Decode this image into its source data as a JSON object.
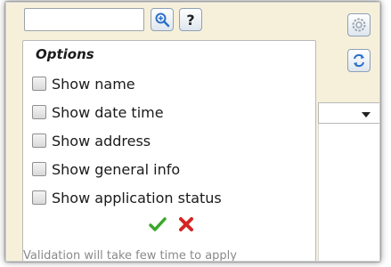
{
  "search": {
    "value": "",
    "placeholder": ""
  },
  "toolbar": {
    "help_label": "?"
  },
  "icons": {
    "zoom": "magnifier-plus-icon",
    "settings": "gear-icon",
    "refresh": "refresh-icon",
    "confirm": "checkmark-icon",
    "cancel": "cross-icon"
  },
  "options": {
    "title": "Options",
    "items": [
      {
        "label": "Show name",
        "checked": false
      },
      {
        "label": "Show date time",
        "checked": false
      },
      {
        "label": "Show address",
        "checked": false
      },
      {
        "label": "Show general info",
        "checked": false
      },
      {
        "label": "Show application status",
        "checked": false
      }
    ],
    "note": "Validation will take few time to apply"
  },
  "colors": {
    "confirm": "#3aa82a",
    "cancel": "#d42424",
    "accent": "#2b6fc9"
  }
}
